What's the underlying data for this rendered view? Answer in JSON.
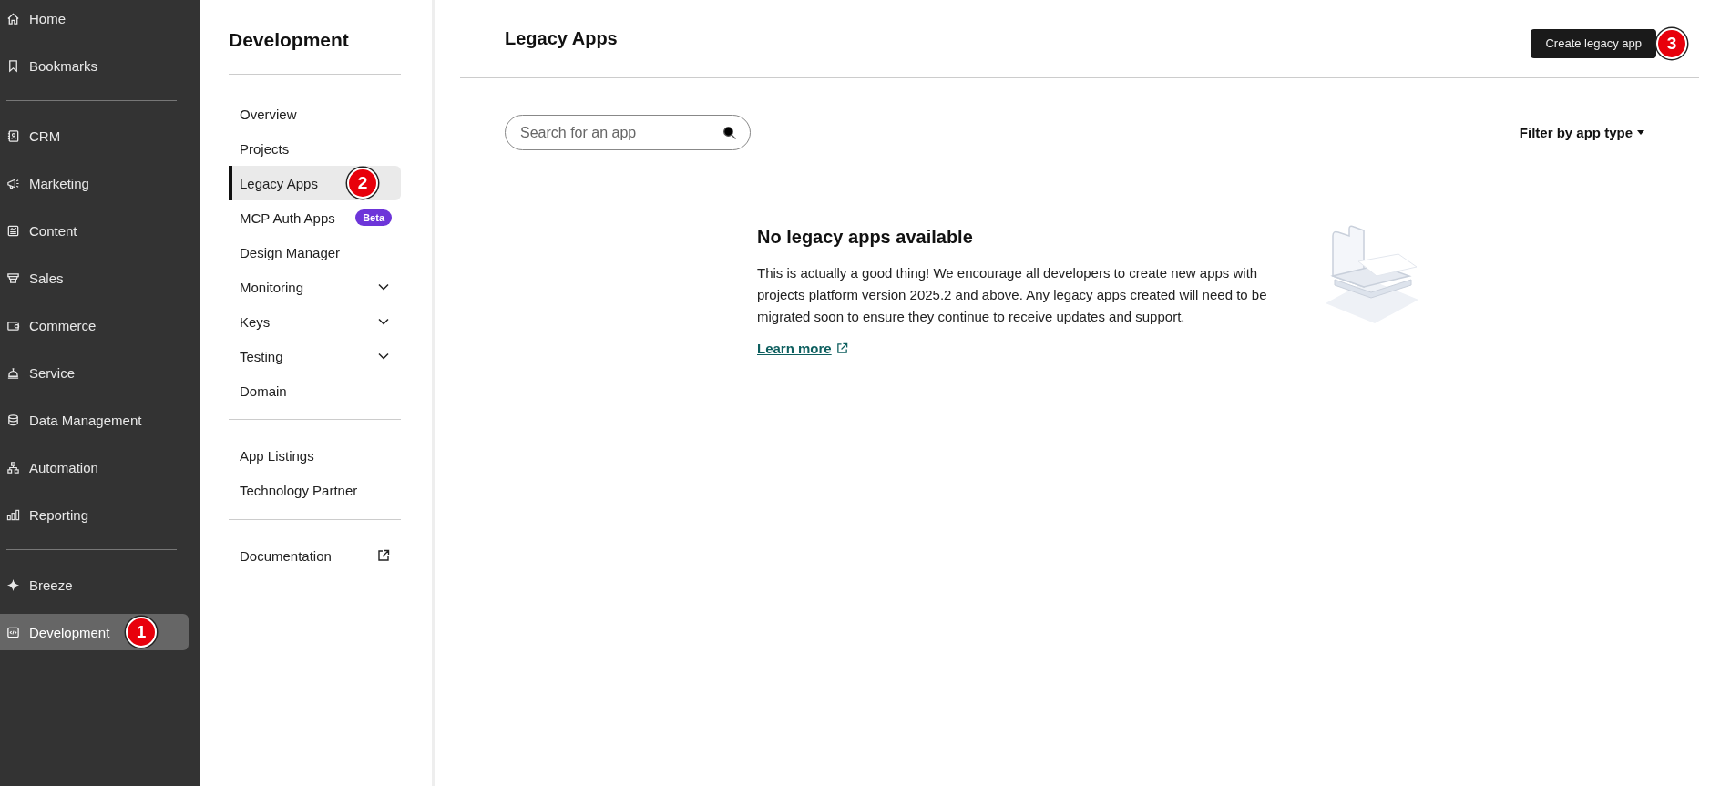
{
  "sidebar": {
    "groups": [
      {
        "items": [
          {
            "label": "Home",
            "selected": false
          },
          {
            "label": "Bookmarks",
            "selected": false
          }
        ]
      },
      {
        "items": [
          {
            "label": "CRM",
            "selected": false
          },
          {
            "label": "Marketing",
            "selected": false
          },
          {
            "label": "Content",
            "selected": false
          },
          {
            "label": "Sales",
            "selected": false
          },
          {
            "label": "Commerce",
            "selected": false
          },
          {
            "label": "Service",
            "selected": false
          },
          {
            "label": "Data Management",
            "selected": false
          },
          {
            "label": "Automation",
            "selected": false
          },
          {
            "label": "Reporting",
            "selected": false
          }
        ]
      },
      {
        "items": [
          {
            "label": "Breeze",
            "selected": false
          },
          {
            "label": "Development",
            "selected": true,
            "annotation": "1"
          }
        ]
      }
    ]
  },
  "subnav": {
    "title": "Development",
    "groups": [
      {
        "items": [
          {
            "label": "Overview",
            "selected": false
          },
          {
            "label": "Projects",
            "selected": false
          },
          {
            "label": "Legacy Apps",
            "selected": true,
            "annotation": "2"
          },
          {
            "label": "MCP Auth Apps",
            "selected": false,
            "badge": "Beta"
          },
          {
            "label": "Design Manager",
            "selected": false
          },
          {
            "label": "Monitoring",
            "selected": false,
            "expanded": false
          },
          {
            "label": "Keys",
            "selected": false,
            "expanded": false
          },
          {
            "label": "Testing",
            "selected": false,
            "expanded": false
          },
          {
            "label": "Domain",
            "selected": false
          }
        ]
      },
      {
        "items": [
          {
            "label": "App Listings",
            "selected": false
          },
          {
            "label": "Technology Partner",
            "selected": false
          }
        ]
      },
      {
        "items": [
          {
            "label": "Documentation",
            "selected": false,
            "external": true
          }
        ]
      }
    ]
  },
  "header": {
    "title": "Legacy Apps",
    "button": {
      "label": "Create legacy app",
      "annotation": "3"
    }
  },
  "search": {
    "placeholder": "Search for an app"
  },
  "filter": {
    "label": "Filter by app type"
  },
  "empty_state": {
    "title": "No legacy apps available",
    "body": "This is actually a good thing! We encourage all developers to create new apps with projects platform version 2025.2 and above. Any legacy apps created will need to be migrated soon to ensure they continue to receive updates and support.",
    "link": "Learn more"
  }
}
